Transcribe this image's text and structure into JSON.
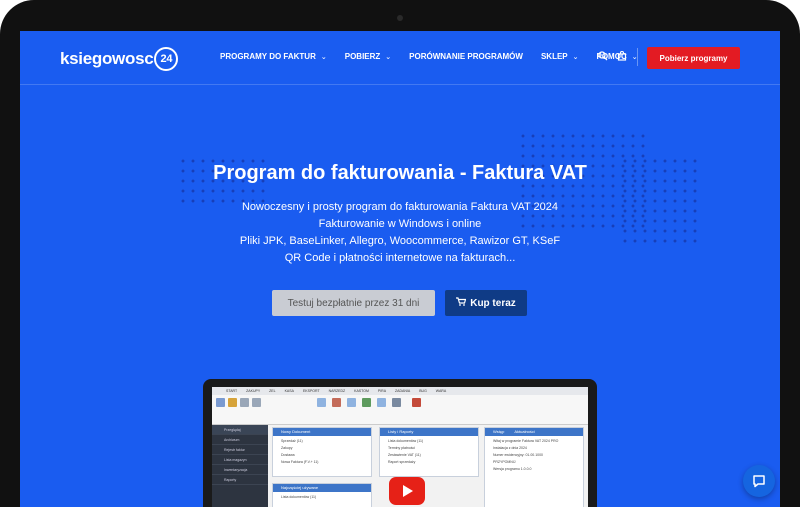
{
  "brand": {
    "logo_text": "ksiegowosc",
    "logo_badge": "24"
  },
  "nav": {
    "items": [
      {
        "label": "PROGRAMY DO FAKTUR",
        "has_dropdown": true
      },
      {
        "label": "POBIERZ",
        "has_dropdown": true
      },
      {
        "label": "PORÓWNANIE PROGRAMÓW",
        "has_dropdown": false
      },
      {
        "label": "SKLEP",
        "has_dropdown": true
      },
      {
        "label": "POMOC",
        "has_dropdown": true
      }
    ],
    "chevron": "⌄",
    "search_icon": "search-icon",
    "cart_icon": "cart-icon",
    "cta_label": "Pobierz programy"
  },
  "hero": {
    "title": "Program do fakturowania - Faktura VAT",
    "lines": [
      "Nowoczesny i prosty program do fakturowania Faktura VAT 2024",
      "Fakturowanie w Windows i online",
      "Pliki JPK, BaseLinker, Allegro, Woocommerce, Rawizor GT, KSeF",
      "QR Code i płatności internetowe na fakturach..."
    ],
    "trial_button": "Testuj bezpłatnie przez 31 dni",
    "buy_button": "Kup teraz"
  },
  "app_preview": {
    "ribbon_tabs": [
      "START",
      "ZAKUPY",
      "ZEL",
      "KASA",
      "EKSPORT",
      "NARZEDZ",
      "KASTOM",
      "PIRA",
      "ZADANIA",
      "BUG",
      "WARA"
    ],
    "sidebar": [
      "Przeglądaj",
      "Archiwum",
      "Rejestr faktur",
      "Lista magazyn",
      "Inwentaryzacja",
      "Raporty"
    ],
    "panels": [
      {
        "title": "Nowy Dokument",
        "rows": [
          "Sprzedaż (11)",
          "Zakupy",
          "Dostawa",
          "Nowa Faktura (F.V.+ 11)"
        ]
      },
      {
        "title": "Listy i Raporty",
        "rows": [
          "Lista dokumentów (11)",
          "Terminy płatności",
          "Zestawienie VAT (11)",
          "Raport sprzedaży"
        ]
      },
      {
        "title": "Wstęp",
        "tab2": "Aktualności",
        "rows": [
          "Witaj w programie Faktura VAT 2024 PRO",
          "Instalacja z dnia 2024",
          "Numer ewidencyjny: 01.00.1000",
          "PRZYPOMNIJ",
          "Wersja programu 1.0.0.0"
        ]
      },
      {
        "title": "Najczęściej używane",
        "rows": [
          "Lista dokumentów (11)"
        ]
      }
    ]
  },
  "colors": {
    "hero_bg": "#1a5cf0",
    "cta": "#e31b23",
    "buy": "#0f3b86",
    "trial": "#c9ccd3"
  },
  "chat_icon": "chat-icon"
}
